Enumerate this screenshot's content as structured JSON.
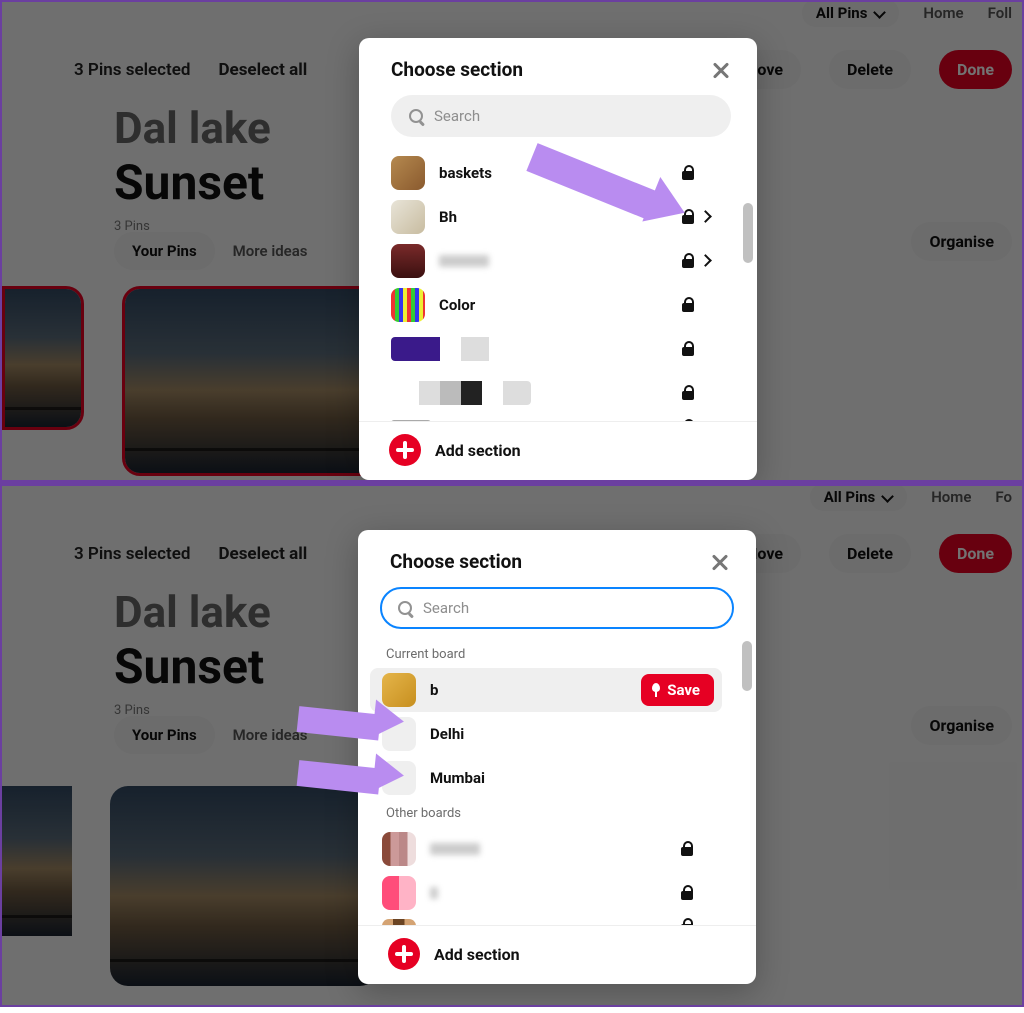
{
  "topnav": {
    "all_pins": "All Pins",
    "home": "Home",
    "following": "Foll"
  },
  "actions": {
    "selected": "3 Pins selected",
    "deselect": "Deselect all",
    "move": "Move",
    "delete": "Delete",
    "done": "Done"
  },
  "board": {
    "name_line1": "Dal lake",
    "name_line2": "Sunset",
    "count": "3 Pins"
  },
  "tabs": {
    "your_pins": "Your Pins",
    "more_ideas": "More ideas",
    "organise": "Organise"
  },
  "modal": {
    "title": "Choose section",
    "search_placeholder": "Search",
    "add_section": "Add section",
    "save": "Save",
    "labels": {
      "current_board": "Current board",
      "other_boards": "Other boards"
    },
    "top_list": [
      {
        "name": "baskets",
        "lock": true,
        "chev": false
      },
      {
        "name": "Bh",
        "lock": true,
        "chev": true
      },
      {
        "name": "",
        "lock": true,
        "chev": true,
        "blur": true
      },
      {
        "name": "Color",
        "lock": true,
        "chev": false
      },
      {
        "name": "",
        "lock": true,
        "chev": false,
        "blur": true
      },
      {
        "name": "",
        "lock": true,
        "chev": false,
        "blur": true
      },
      {
        "name": "",
        "lock": true,
        "chev": false,
        "blur": true
      }
    ],
    "bottom_current": [
      {
        "name": "b",
        "save": true
      },
      {
        "name": "Delhi"
      },
      {
        "name": "Mumbai"
      }
    ],
    "bottom_other": [
      {
        "name": "",
        "lock": true,
        "blur": true
      },
      {
        "name": "",
        "lock": true,
        "blur": true
      },
      {
        "name": "",
        "lock": true,
        "blur": true
      }
    ]
  },
  "topnav2": {
    "following": "Fo"
  }
}
